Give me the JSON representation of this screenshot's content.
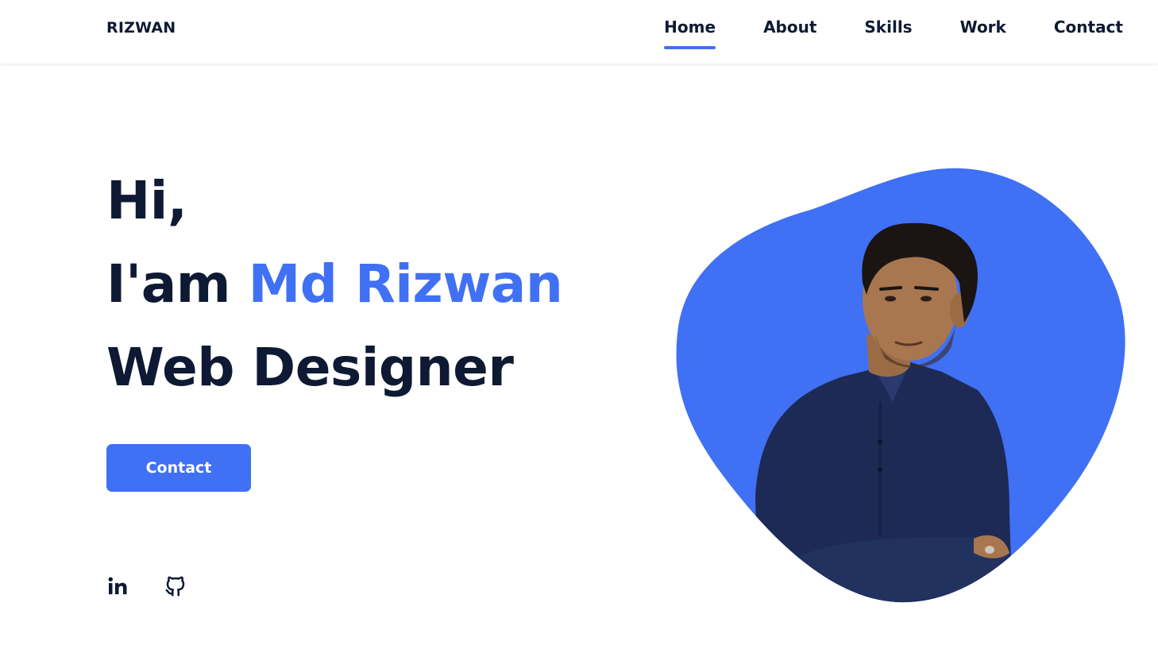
{
  "header": {
    "logo": "RIZWAN",
    "nav": [
      {
        "label": "Home",
        "active": true
      },
      {
        "label": "About",
        "active": false
      },
      {
        "label": "Skills",
        "active": false
      },
      {
        "label": "Work",
        "active": false
      },
      {
        "label": "Contact",
        "active": false
      }
    ]
  },
  "hero": {
    "line1": "Hi,",
    "line2_prefix": "I'am ",
    "line2_name": "Md Rizwan",
    "line3": "Web Designer",
    "cta_label": "Contact"
  },
  "social": {
    "icons": [
      "linkedin-icon",
      "github-icon"
    ]
  },
  "colors": {
    "accent": "#4070f4",
    "text": "#0e1a33",
    "shirt": "#1c2a55",
    "skin": "#a8764f",
    "hair": "#1a1512"
  }
}
